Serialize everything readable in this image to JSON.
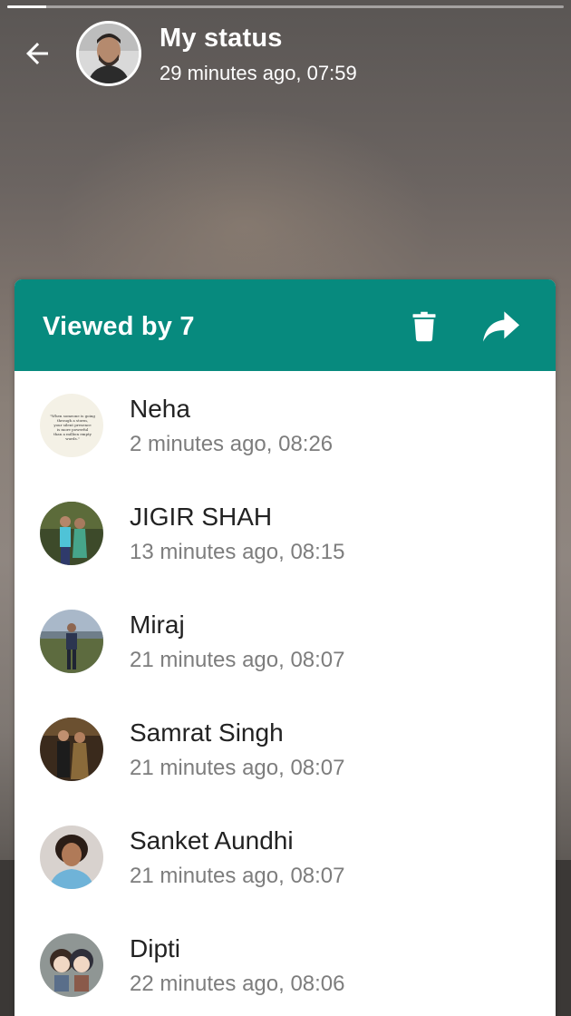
{
  "status": {
    "title": "My status",
    "subtitle": "29 minutes ago, 07:59",
    "progress": 0.07
  },
  "icons": {
    "back": "arrow-left-icon",
    "delete": "trash-icon",
    "forward": "share-forward-icon"
  },
  "colors": {
    "accent": "#078a7e",
    "name_text": "#222222",
    "time_text": "#7d7d7d"
  },
  "sheet": {
    "title": "Viewed by 7"
  },
  "viewers": [
    {
      "name": "Neha",
      "time": "2 minutes ago, 08:26"
    },
    {
      "name": "JIGIR SHAH",
      "time": "13 minutes ago, 08:15"
    },
    {
      "name": "Miraj",
      "time": "21 minutes ago, 08:07"
    },
    {
      "name": "Samrat Singh",
      "time": "21 minutes ago, 08:07"
    },
    {
      "name": "Sanket Aundhi",
      "time": "21 minutes ago, 08:07"
    },
    {
      "name": "Dipti",
      "time": "22 minutes ago, 08:06"
    }
  ]
}
